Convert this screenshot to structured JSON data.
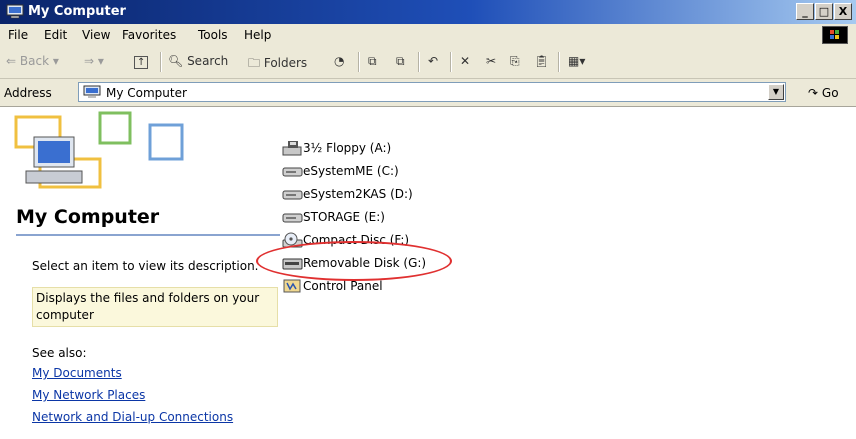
{
  "window": {
    "title": "My Computer"
  },
  "menu": [
    "File",
    "Edit",
    "View",
    "Favorites",
    "Tools",
    "Help"
  ],
  "toolbar": {
    "back": "Back",
    "search": "Search",
    "folders": "Folders"
  },
  "address": {
    "label": "Address",
    "value": "My Computer",
    "go": "Go"
  },
  "left_panel": {
    "title": "My Computer",
    "prompt": "Select an item to view its description.",
    "info": "Displays the files and folders on your computer",
    "see_also": "See also:",
    "links": [
      "My Documents",
      "My Network Places",
      "Network and Dial-up Connections"
    ]
  },
  "drives": [
    {
      "label": "3½ Floppy (A:)",
      "icon": "floppy-drive-icon"
    },
    {
      "label": "eSystemME (C:)",
      "icon": "hard-drive-icon"
    },
    {
      "label": "eSystem2KAS (D:)",
      "icon": "hard-drive-icon"
    },
    {
      "label": "STORAGE (E:)",
      "icon": "hard-drive-icon"
    },
    {
      "label": "Compact Disc (F:)",
      "icon": "cd-drive-icon"
    },
    {
      "label": "Removable Disk (G:)",
      "icon": "removable-disk-icon"
    },
    {
      "label": "Control Panel",
      "icon": "control-panel-icon"
    }
  ],
  "colors": {
    "title_bar": "#0a246a",
    "link": "#0b36a6",
    "highlight_circle": "#e03030"
  }
}
